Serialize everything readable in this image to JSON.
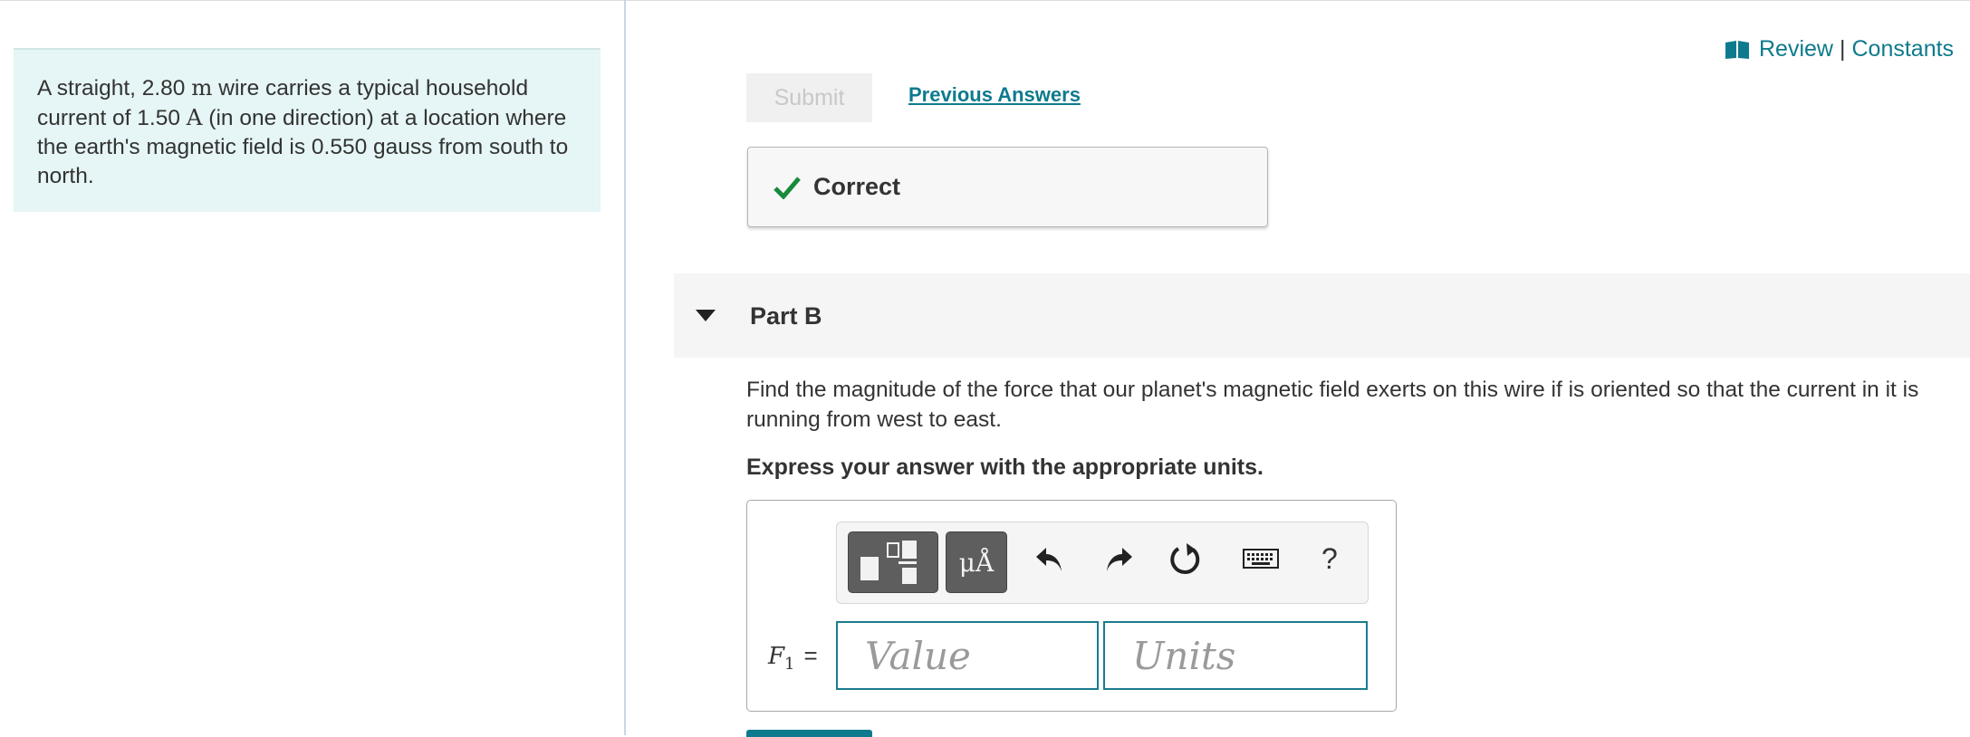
{
  "problem": {
    "segments": [
      {
        "text": "A straight, 2.80 "
      },
      {
        "text": "m",
        "math": true
      },
      {
        "text": " wire carries a typical household current of 1.50 "
      },
      {
        "text": "A",
        "math": true
      },
      {
        "text": " (in one direction) at a location where the earth's magnetic field is 0.550 gauss from south to north."
      }
    ]
  },
  "header": {
    "review_label": "Review",
    "separator": "|",
    "constants_label": "Constants",
    "icon": "book-icon"
  },
  "part_a": {
    "submit_label": "Submit",
    "previous_answers_label": "Previous Answers",
    "feedback_label": "Correct",
    "feedback_color": "#188a3c"
  },
  "part_b": {
    "title": "Part B",
    "question": "Find the magnitude of the force that our planet's magnetic field exerts on this wire if is oriented so that the current in it is running from west to east.",
    "instruction": "Express your answer with the appropriate units.",
    "toolbar": {
      "units_symbol": "μÅ",
      "help_label": "?"
    },
    "variable": "F",
    "variable_subscript": "1",
    "equals": "=",
    "value_placeholder": "Value",
    "units_placeholder": "Units"
  },
  "colors": {
    "accent": "#0e7a8d",
    "problem_bg": "#e6f5f5",
    "check": "#188a3c"
  }
}
